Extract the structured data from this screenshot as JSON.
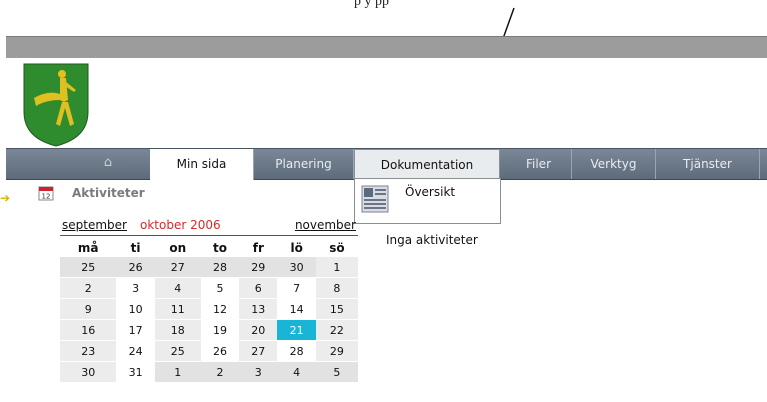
{
  "caption": "p                                               y     pp",
  "nav": {
    "tabs": [
      {
        "label": "Min sida"
      },
      {
        "label": "Planering"
      },
      {
        "label": "Dokumentation"
      },
      {
        "label": "Filer"
      },
      {
        "label": "Verktyg"
      },
      {
        "label": "Tjänster"
      }
    ]
  },
  "dropdown": {
    "item_label": "Översikt"
  },
  "activities": {
    "title": "Aktiviteter",
    "empty_text": "Inga aktiviteter"
  },
  "calendar": {
    "prev_month": "september",
    "current_month": "oktober 2006",
    "next_month": "november",
    "weekdays": [
      "må",
      "ti",
      "on",
      "to",
      "fr",
      "lö",
      "sö"
    ],
    "weeks": [
      [
        "25",
        "26",
        "27",
        "28",
        "29",
        "30",
        "1"
      ],
      [
        "2",
        "3",
        "4",
        "5",
        "6",
        "7",
        "8"
      ],
      [
        "9",
        "10",
        "11",
        "12",
        "13",
        "14",
        "15"
      ],
      [
        "16",
        "17",
        "18",
        "19",
        "20",
        "21",
        "22"
      ],
      [
        "23",
        "24",
        "25",
        "26",
        "27",
        "28",
        "29"
      ],
      [
        "30",
        "31",
        "1",
        "2",
        "3",
        "4",
        "5"
      ]
    ],
    "today": "21"
  },
  "colors": {
    "nav_bg": "#6b7888",
    "today": "#19b5d6",
    "current_month": "#d42a2a",
    "logo_green": "#2e8b2e",
    "logo_gold": "#e0c020"
  }
}
